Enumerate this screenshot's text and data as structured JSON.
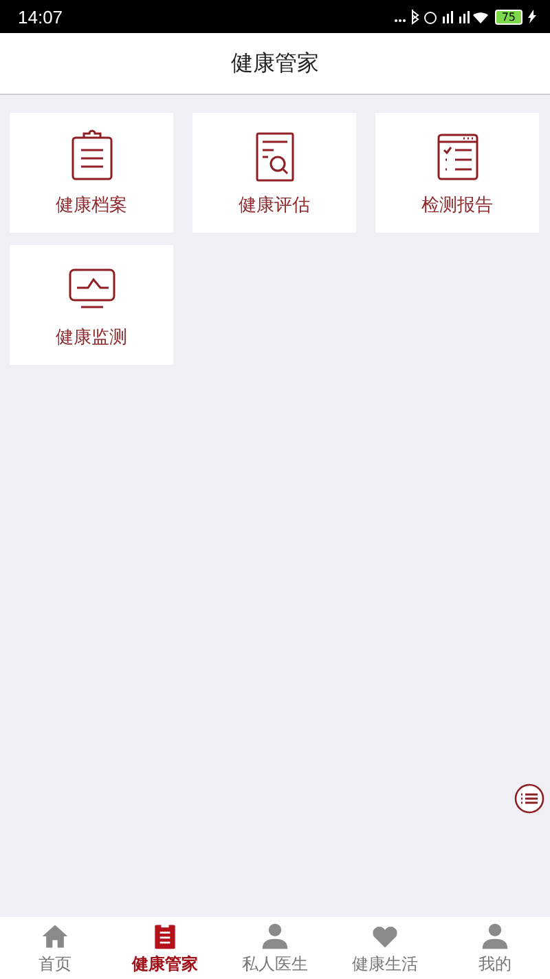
{
  "status_bar": {
    "time": "14:07",
    "battery": "75"
  },
  "header": {
    "title": "健康管家"
  },
  "tiles": [
    {
      "label": "健康档案",
      "kind": "clipboard"
    },
    {
      "label": "健康评估",
      "kind": "assessment"
    },
    {
      "label": "检测报告",
      "kind": "report"
    },
    {
      "label": "健康监测",
      "kind": "monitor"
    }
  ],
  "tab_bar": [
    {
      "label": "首页",
      "kind": "home",
      "selected": false
    },
    {
      "label": "健康管家",
      "kind": "clipboard",
      "selected": true
    },
    {
      "label": "私人医生",
      "kind": "person",
      "selected": false
    },
    {
      "label": "健康生活",
      "kind": "heart",
      "selected": false
    },
    {
      "label": "我的",
      "kind": "person",
      "selected": false
    }
  ]
}
